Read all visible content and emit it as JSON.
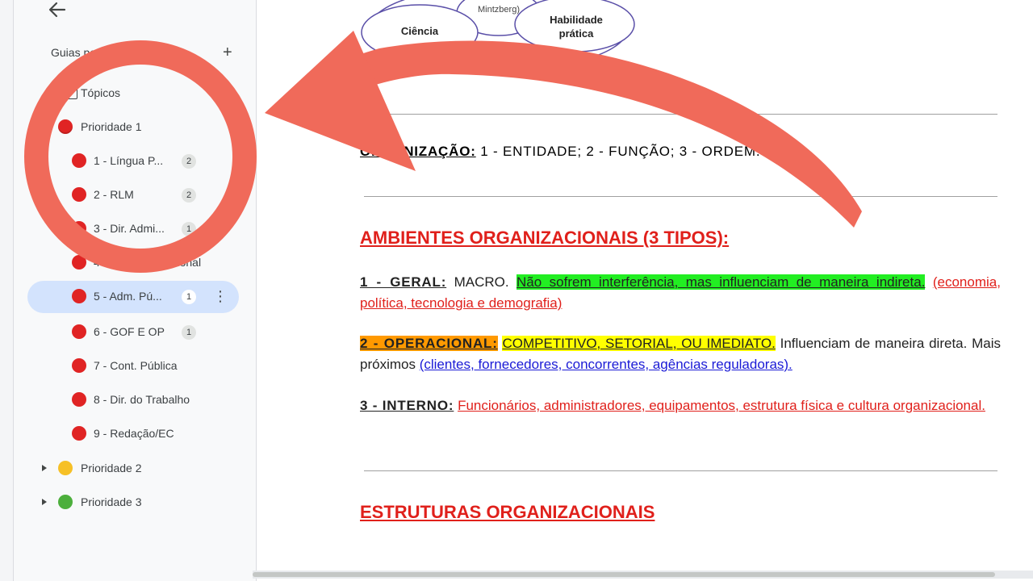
{
  "sidebar": {
    "back_icon": "arrow-left-icon",
    "guides_label": "Guias pessoais",
    "add_icon": "plus-icon",
    "items": [
      {
        "label": "Tópicos",
        "icon": "document-icon",
        "badge": ""
      },
      {
        "label": "Prioridade 1",
        "icon": "red-circle-icon",
        "badge": ""
      },
      {
        "label": "1 - Língua P...",
        "icon": "red-circle-icon",
        "badge": "2"
      },
      {
        "label": "2 - RLM",
        "icon": "red-circle-icon",
        "badge": "2"
      },
      {
        "label": "3 - Dir. Admi...",
        "icon": "red-circle-icon",
        "badge": "1"
      },
      {
        "label": "4 - Dir. Constitucional",
        "icon": "red-circle-icon",
        "badge": ""
      },
      {
        "label": "5 - Adm. Pú...",
        "icon": "red-circle-icon",
        "badge": "1",
        "active": true
      },
      {
        "label": "6 - GOF E OP",
        "icon": "red-circle-icon",
        "badge": "1"
      },
      {
        "label": "7 - Cont. Pública",
        "icon": "red-circle-icon",
        "badge": ""
      },
      {
        "label": "8 - Dir. do Trabalho",
        "icon": "red-circle-icon",
        "badge": ""
      },
      {
        "label": "9 - Redação/EC",
        "icon": "red-circle-icon",
        "badge": ""
      },
      {
        "label": "Prioridade 2",
        "icon": "yellow-circle-icon",
        "badge": ""
      },
      {
        "label": "Prioridade 3",
        "icon": "green-circle-icon",
        "badge": ""
      }
    ]
  },
  "document": {
    "diagram": {
      "mintzberg": "Mintzberg)",
      "ciencia": "Ciência",
      "habilidade_1": "Habilidade",
      "habilidade_2": "prática"
    },
    "organizacao": {
      "term": "ORGANIZAÇÃO:",
      "text": "1 - ENTIDADE; 2 - FUNÇÃO; 3 - ORDEM."
    },
    "ambientes_heading": "AMBIENTES ORGANIZACIONAIS (3 TIPOS):",
    "geral": {
      "term": "1 - GERAL:",
      "plain": "MACRO.",
      "highlight": "Não sofrem interferência, mas influenciam de maneira indireta.",
      "detail": "(economia, política, tecnologia e demografia)"
    },
    "operacional": {
      "term": "2 - OPERACIONAL:",
      "highlight": "COMPETITIVO, SETORIAL, OU IMEDIATO.",
      "plain": "Influenciam de maneira direta. Mais próximos",
      "detail": "(clientes, fornecedores, concorrentes, agências reguladoras)."
    },
    "interno": {
      "term": "3 - INTERNO:",
      "detail": "Funcionários, administradores, equipamentos, estrutura física e cultura organizacional."
    },
    "estruturas_heading": "ESTRUTURAS ORGANIZACIONAIS"
  },
  "colors": {
    "annotation": "#f06a5a",
    "heading_red": "#e0201b",
    "highlight_green": "#22ee22",
    "highlight_yellow": "#ffff00",
    "highlight_orange": "#ff9900",
    "link_blue": "#1a1ad6",
    "active_item": "#d3e3fd"
  }
}
